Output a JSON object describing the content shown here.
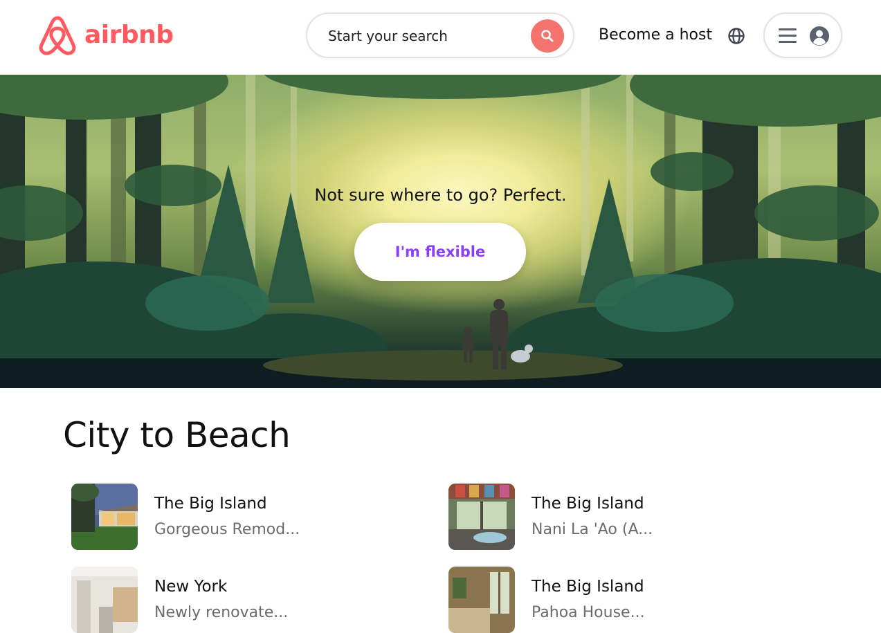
{
  "header": {
    "logo_text": "airbnb",
    "search": {
      "placeholder": "Start your search"
    },
    "host_link": "Become a host"
  },
  "hero": {
    "tagline": "Not sure where to go? Perfect.",
    "button_label": "I'm flexible"
  },
  "section": {
    "title": "City to Beach",
    "listings": [
      {
        "title": "The Big Island",
        "subtitle": "Gorgeous Remod..."
      },
      {
        "title": "The Big Island",
        "subtitle": "Nani La 'Ao (A..."
      },
      {
        "title": "New York",
        "subtitle": "Newly renovate..."
      },
      {
        "title": "The Big Island",
        "subtitle": "Pahoa House..."
      }
    ]
  },
  "colors": {
    "brand": "#ff5a5f",
    "search_button": "#f4736d",
    "flexible_text": "#8a3ffc"
  },
  "icons": [
    "airbnb-logo-icon",
    "search-icon",
    "globe-icon",
    "hamburger-icon",
    "user-avatar-icon"
  ]
}
